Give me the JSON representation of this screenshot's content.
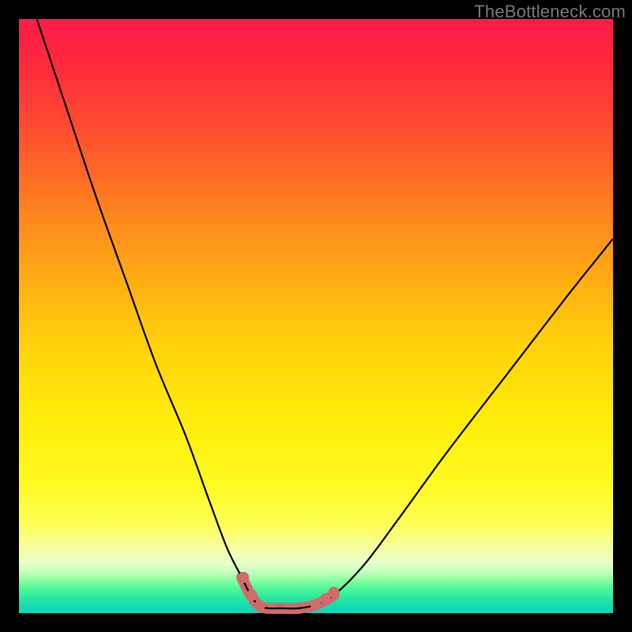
{
  "watermark": "TheBottleneck.com",
  "chart_data": {
    "type": "line",
    "title": "",
    "xlabel": "",
    "ylabel": "",
    "xlim": [
      0,
      100
    ],
    "ylim": [
      0,
      100
    ],
    "grid": false,
    "legend": false,
    "background_gradient": {
      "direction": "vertical",
      "stops": [
        {
          "pos": 0,
          "color": "#ff1a4d"
        },
        {
          "pos": 30,
          "color": "#ff7a20"
        },
        {
          "pos": 55,
          "color": "#ffd20a"
        },
        {
          "pos": 85,
          "color": "#fdff55"
        },
        {
          "pos": 93,
          "color": "#c8ffc0"
        },
        {
          "pos": 100,
          "color": "#0ad8c8"
        }
      ]
    },
    "series": [
      {
        "name": "bottleneck-curve",
        "color": "#000000",
        "x": [
          3,
          8,
          13,
          18,
          23,
          28,
          32,
          35,
          37.5,
          39,
          40.5,
          42,
          44,
          47,
          50,
          53,
          58,
          64,
          72,
          82,
          92,
          100
        ],
        "values": [
          100,
          85,
          70,
          56,
          42,
          30,
          19,
          11,
          6,
          3,
          1.2,
          0.8,
          0.8,
          0.8,
          1.4,
          3,
          8,
          16,
          27,
          40,
          53,
          63
        ]
      },
      {
        "name": "flat-bottom-highlight",
        "color": "#d26a6a",
        "stroke_width": 14,
        "linecap": "round",
        "x": [
          37.5,
          39,
          40.5,
          42,
          44,
          47,
          50,
          53
        ],
        "values": [
          6,
          3,
          1.2,
          0.8,
          0.8,
          0.8,
          1.4,
          3
        ]
      }
    ],
    "markers": [
      {
        "x": 37.8,
        "y": 6,
        "r": 7,
        "color": "#d26a6a"
      },
      {
        "x": 39.2,
        "y": 3,
        "r": 7,
        "color": "#d26a6a"
      },
      {
        "x": 40.5,
        "y": 1.2,
        "r": 7,
        "color": "#d26a6a"
      },
      {
        "x": 50.0,
        "y": 1.4,
        "r": 7,
        "color": "#d26a6a"
      },
      {
        "x": 51.6,
        "y": 2.4,
        "r": 7,
        "color": "#d26a6a"
      },
      {
        "x": 53.0,
        "y": 3.5,
        "r": 7,
        "color": "#d26a6a"
      }
    ]
  }
}
